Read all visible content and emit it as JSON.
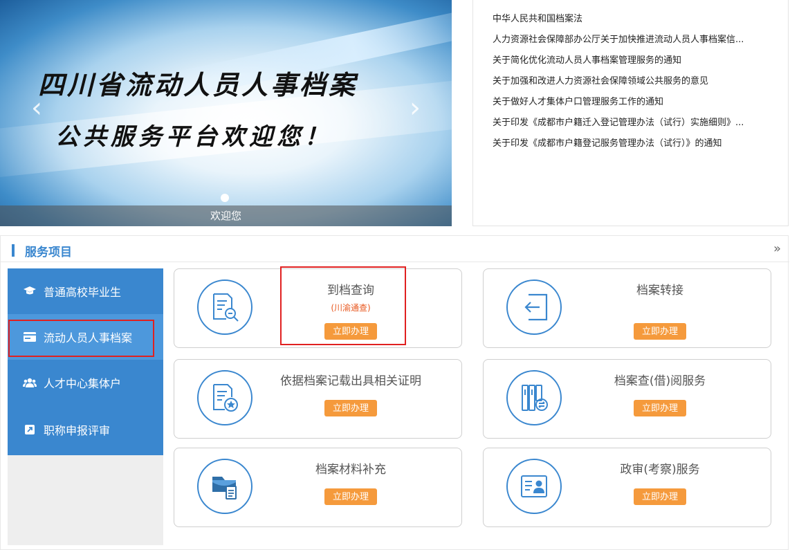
{
  "banner": {
    "title_line1": "四川省流动人员人事档案",
    "title_line2": "公共服务平台欢迎您！",
    "caption": "欢迎您",
    "prev_icon": "chevron-left-icon",
    "next_icon": "chevron-right-icon"
  },
  "news": {
    "items": [
      "中华人民共和国档案法",
      "人力资源社会保障部办公厅关于加快推进流动人员人事档案信...",
      "关于简化优化流动人员人事档案管理服务的通知",
      "关于加强和改进人力资源社会保障领域公共服务的意见",
      "关于做好人才集体户口管理服务工作的通知",
      "关于印发《成都市户籍迁入登记管理办法（试行）实施细则》...",
      "关于印发《成都市户籍登记服务管理办法（试行）》的通知"
    ]
  },
  "services": {
    "title": "服务项目",
    "more": "»",
    "sidebar": [
      {
        "label": "普通高校毕业生",
        "icon": "graduation-cap-icon"
      },
      {
        "label": "流动人员人事档案",
        "icon": "id-card-icon"
      },
      {
        "label": "人才中心集体户",
        "icon": "users-icon"
      },
      {
        "label": "职称申报评审",
        "icon": "external-link-icon"
      }
    ],
    "cards": [
      {
        "title": "到档查询",
        "subtitle": "(川渝通查)",
        "button": "立即办理",
        "icon": "document-search-icon"
      },
      {
        "title": "档案转接",
        "subtitle": "",
        "button": "立即办理",
        "icon": "arrow-in-icon"
      },
      {
        "title": "依据档案记载出具相关证明",
        "subtitle": "",
        "button": "立即办理",
        "icon": "certificate-icon"
      },
      {
        "title": "档案查(借)阅服务",
        "subtitle": "",
        "button": "立即办理",
        "icon": "binders-icon"
      },
      {
        "title": "档案材料补充",
        "subtitle": "",
        "button": "立即办理",
        "icon": "folder-add-icon"
      },
      {
        "title": "政审(考察)服务",
        "subtitle": "",
        "button": "立即办理",
        "icon": "profile-card-icon"
      }
    ]
  },
  "colors": {
    "accent": "#3a87cf",
    "button": "#f59a3c",
    "highlight_border": "#e02020",
    "subtitle": "#e8571e"
  }
}
